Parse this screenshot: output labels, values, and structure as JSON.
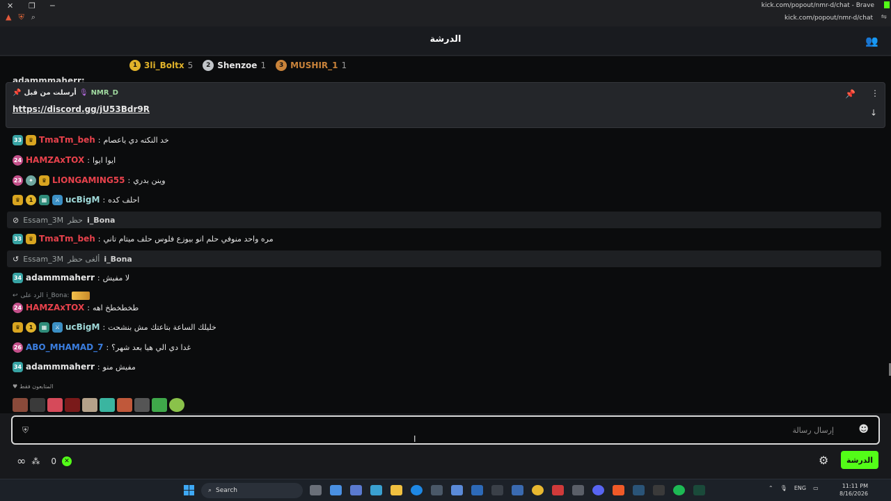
{
  "browser": {
    "url_top": "kick.com/popout/nmr-d/chat - Brave",
    "url": "kick.com/popout/nmr-d/chat"
  },
  "header": {
    "title": "الدرشة"
  },
  "leaderboard": [
    {
      "rank": "1",
      "name": "3li_Boltx",
      "count": "5",
      "color": "#e0b22a"
    },
    {
      "rank": "2",
      "name": "Shenzoe",
      "count": "1",
      "color": "#c0c4c8"
    },
    {
      "rank": "3",
      "name": "MUSHIR_1",
      "count": "1",
      "color": "#c9833a"
    }
  ],
  "peek_row": "adammmaherr:",
  "pinned": {
    "pinned_by_label": "أرسلت من قبل",
    "user": "NMR_D",
    "link": "https://discord.gg/jU53Bdr9R"
  },
  "messages": [
    {
      "user": "TmaTm_beh",
      "text": "خد النكته دي ياعصام",
      "color": "#e8424c",
      "badge": "33"
    },
    {
      "user": "HAMZAxTOX",
      "text": "ايوا ايوا",
      "color": "#e8424c",
      "badge": "24"
    },
    {
      "user": "LIONGAMING55",
      "text": "وينن بدري",
      "color": "#e8424c",
      "badge": "23"
    },
    {
      "user": "ucBigM",
      "text": "احلف كده",
      "color": "#9fd9d9"
    },
    {
      "user": "TmaTm_beh",
      "text": "مره واحد منوفي حلم انو بيوزع فلوس حلف ميتام تاني",
      "color": "#e8424c",
      "badge": "33"
    },
    {
      "user": "adammmaherr",
      "text": "لا مفيش",
      "color": "#e6e6e6",
      "badge": "34"
    },
    {
      "user": "HAMZAxTOX",
      "text": "طخطخطخ اهه",
      "color": "#e8424c",
      "badge": "24"
    },
    {
      "user": "ucBigM",
      "text": "خليلك الساعة بتاعتك مش بنشحت",
      "color": "#9fd9d9"
    },
    {
      "user": "ABO_MHAMAD_7",
      "text": "غدا دي الي هيا بعد شهر؟",
      "color": "#3b7ee0",
      "badge": "26"
    },
    {
      "user": "adammmaherr",
      "text": "مفيش منو",
      "color": "#e6e6e6",
      "badge": "34"
    }
  ],
  "mod_actions": [
    {
      "mod": "Essam_3M",
      "verb": "حظر",
      "target": "i_Bona"
    },
    {
      "mod": "Essam_3M",
      "verb": "ألغى حظر",
      "target": "i_Bona"
    }
  ],
  "reply": {
    "label": "الرد على",
    "user": "i_Bona:"
  },
  "emote_bar": {
    "label": "المتابعون فقط"
  },
  "input": {
    "placeholder": "إرسال رسالة"
  },
  "bottom": {
    "count": "0",
    "chat_button": "الدرشة"
  },
  "taskbar": {
    "search": "Search",
    "lang": "ENG",
    "time": "11:11 PM",
    "date": "8/16/2026"
  },
  "colors": {
    "accent": "#53fc18",
    "bg": "#0b0c0d"
  }
}
